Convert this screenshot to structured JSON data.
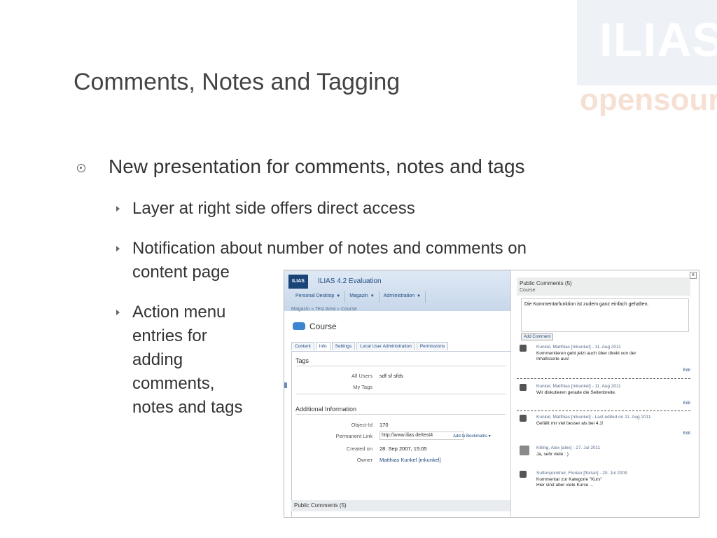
{
  "logo": {
    "top": "ILIAS",
    "bottom": "opensour"
  },
  "title": "Comments, Notes and Tagging",
  "bullet_main": "New presentation for comments, notes and tags",
  "bullets": [
    "Layer at right side offers direct access",
    "Notification about number of notes and comments on",
    "content page",
    "Action menu",
    "entries for",
    "adding",
    "comments,",
    "notes and tags"
  ],
  "shot": {
    "app_logo": "ILIAS",
    "app_title": "ILIAS 4.2 Evaluation",
    "nav": [
      "Personal Desktop",
      "Magazin",
      "Administration"
    ],
    "breadcrumb": "Magazin » Test Area » Course",
    "course_title": "Course",
    "tabs": [
      "Content",
      "Info",
      "Settings",
      "Local User Administration",
      "Permissions"
    ],
    "tags_header": "Tags",
    "all_users_label": "All Users",
    "all_users_value": "sdf sf sfds",
    "my_tags_label": "My Tags",
    "additional_header": "Additional Information",
    "object_id_label": "Object-Id",
    "object_id_value": "170",
    "permanent_link_label": "Permanent Link",
    "permanent_link_value": "http://www.ilias.de/test4",
    "add_bookmarks": "Add to Bookmarks ▾",
    "created_label": "Created on",
    "created_value": "28. Sep 2007, 15:05",
    "owner_label": "Owner",
    "owner_value": "Matthias Kunkel [mkunkel]",
    "public_comments_bar": "Public Comments (5)",
    "side_title": "Public Comments (5)",
    "side_sub": "Course",
    "close": "x",
    "comment_input": "Die Kommentarfunktion ist zudem ganz einfach gehalten.",
    "add_comment": "Add Comment",
    "edit": "Edit",
    "comments": [
      {
        "meta": "Kunkel, Matthias [mkunkel] - 11. Aug 2011",
        "text1": "Kommentieren geht jetzt auch über direkt von der",
        "text2": "Inhaltsseite aus!"
      },
      {
        "meta": "Kunkel, Matthias [mkunkel] - 11. Aug 2011",
        "text1": "Wir diskutieren gerade die Seitenbreite.",
        "text2": ""
      },
      {
        "meta": "Kunkel, Matthias [mkunkel] - Last edited on 11. Aug 2011",
        "text1": "Gefällt mir viel besser als bei 4.1!",
        "text2": ""
      },
      {
        "meta": "Killing, Alex [alex] - 27. Jul 2011",
        "text1": "Ja, sehr viele : )",
        "text2": ""
      },
      {
        "meta": "Suttenpointner, Florian [florian] - 20. Jul 2009",
        "text1": "Kommentar zur Kategorie \"Kurs\"",
        "text2": "Hier sind aber viele Kurse ..."
      }
    ]
  }
}
